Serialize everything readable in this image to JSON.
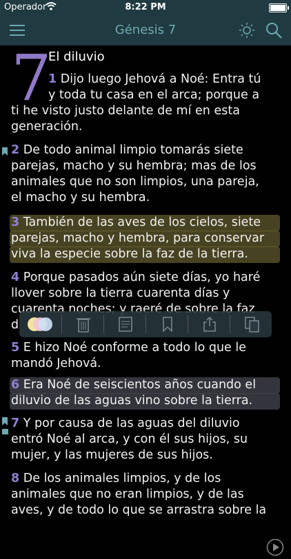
{
  "status": {
    "carrier": "Operador",
    "time": "8:22 PM"
  },
  "nav": {
    "title": "Génesis 7"
  },
  "chapter": {
    "number": "7",
    "heading": "El diluvio"
  },
  "lines": [
    {
      "n": "1",
      "t": "Dijo luego Jehová a Noé: Entra tú"
    },
    {
      "n": "",
      "t": "y toda tu casa en el arca; porque a"
    },
    {
      "n": "",
      "t": "ti he visto justo delante de mí en esta"
    },
    {
      "n": "",
      "t": "generación."
    },
    {
      "n": "2",
      "t": "De todo animal limpio tomarás siete"
    },
    {
      "n": "",
      "t": "parejas, macho y su hembra; mas de los"
    },
    {
      "n": "",
      "t": "animales que no son limpios, una pareja,"
    },
    {
      "n": "",
      "t": "el macho y su hembra."
    },
    {
      "n": "3",
      "t": "También de las aves de los cielos, siete"
    },
    {
      "n": "",
      "t": "parejas, macho y hembra, para conservar"
    },
    {
      "n": "",
      "t": "viva la especie sobre la faz de la tierra."
    },
    {
      "n": "4",
      "t": "Porque pasados aún siete días, yo haré"
    },
    {
      "n": "",
      "t": "llover sobre la tierra cuarenta días y"
    },
    {
      "n": "",
      "t": "cuarenta noches; y raeré de sobre la faz"
    },
    {
      "n": "",
      "t": "d"
    },
    {
      "n": "5",
      "t": "E hizo Noé conforme a todo lo que le"
    },
    {
      "n": "",
      "t": "mandó Jehová."
    },
    {
      "n": "6",
      "t": "Era Noé de seiscientos años cuando el"
    },
    {
      "n": "",
      "t": "diluvio de las aguas vino sobre la tierra."
    },
    {
      "n": "7",
      "t": "Y por causa de las aguas del diluvio"
    },
    {
      "n": "",
      "t": "entró Noé al arca, y con él sus hijos, su"
    },
    {
      "n": "",
      "t": "mujer, y las mujeres de sus hijos."
    },
    {
      "n": "8",
      "t": "De los animales limpios, y de los"
    },
    {
      "n": "",
      "t": "animales que no eran limpios, y de las"
    },
    {
      "n": "",
      "t": "aves, y de todo lo que se arrastra sobre la"
    }
  ],
  "toolbar_icons": [
    "colors-icon",
    "trash-icon",
    "note-icon",
    "bookmark-icon",
    "share-icon",
    "copy-icon"
  ],
  "colors": {
    "bar": "#1f3a40",
    "accent": "#6fa9b3",
    "verse": "#8f7fd0"
  }
}
